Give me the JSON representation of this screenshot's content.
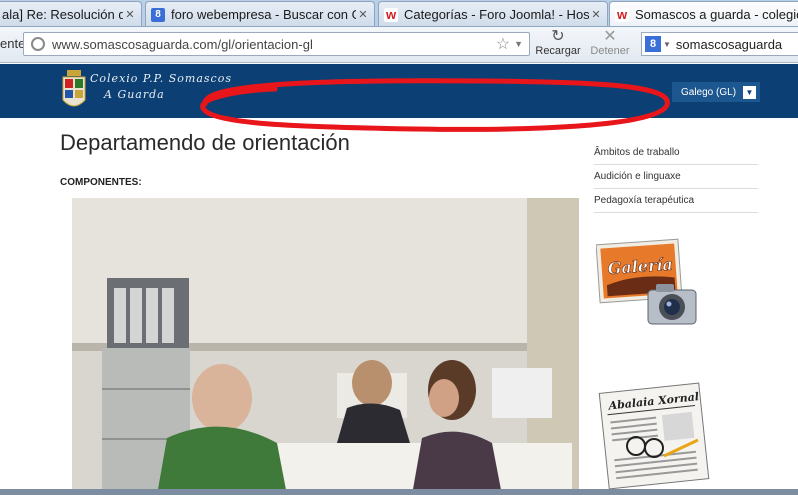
{
  "browser": {
    "tabs": [
      {
        "label": "ala] Re: Resolución de err...",
        "favicon": "",
        "active": false
      },
      {
        "label": "foro webempresa - Buscar con Google",
        "favicon": "8",
        "active": false
      },
      {
        "label": "Categorías - Foro Joomla! - Hosting J...",
        "favicon": "w",
        "active": false
      },
      {
        "label": "Somascos a guarda - colegio somas",
        "favicon": "w",
        "active": true
      }
    ],
    "nav": {
      "left_partial": "ente",
      "url": "www.somascosaguarda.com/gl/orientacion-gl",
      "reload_label": "Recargar",
      "stop_label": "Detener",
      "search_engine_badge": "8",
      "search_value": "somascosaguarda"
    }
  },
  "site": {
    "logo_line1": "Colexio P.P. Somascos",
    "logo_line2": "A Guarda",
    "language": "Galego (GL)",
    "language_arrow": "▼"
  },
  "content": {
    "title": "Departamendo de orientación",
    "subtitle": "COMPONENTES:"
  },
  "sidebar": {
    "links": [
      {
        "label": "Âmbitos de traballo"
      },
      {
        "label": "Audición e linguaxe"
      },
      {
        "label": "Pedagoxía terapéutica"
      }
    ],
    "galeria_label": "Galería",
    "xornal_label": "Abalaia Xornal"
  },
  "colors": {
    "header_bg": "#0c3f73",
    "annotation_red": "#e8161b"
  }
}
